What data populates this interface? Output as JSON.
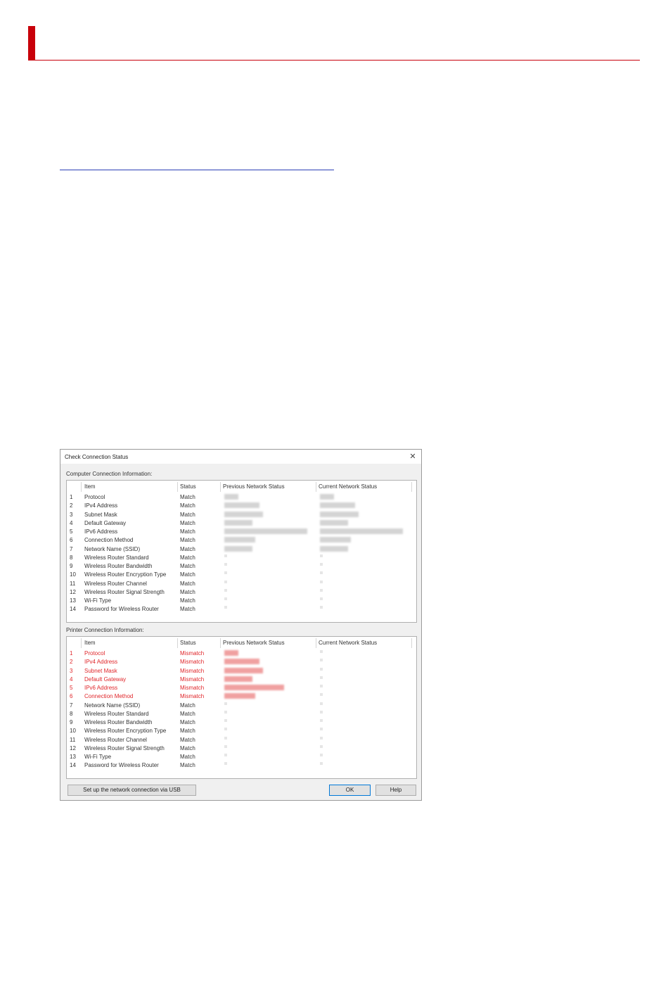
{
  "dialog": {
    "title": "Check Connection Status",
    "close_symbol": "✕",
    "columns": [
      "Item",
      "Status",
      "Previous Network Status",
      "Current Network Status"
    ],
    "computer_label": "Computer Connection Information:",
    "printer_label": "Printer Connection Information:",
    "computer_rows": [
      {
        "num": "1",
        "item": "Protocol",
        "status": "Match"
      },
      {
        "num": "2",
        "item": "IPv4 Address",
        "status": "Match"
      },
      {
        "num": "3",
        "item": "Subnet Mask",
        "status": "Match"
      },
      {
        "num": "4",
        "item": "Default Gateway",
        "status": "Match"
      },
      {
        "num": "5",
        "item": "IPv6 Address",
        "status": "Match"
      },
      {
        "num": "6",
        "item": "Connection Method",
        "status": "Match"
      },
      {
        "num": "7",
        "item": "Network Name (SSID)",
        "status": "Match"
      },
      {
        "num": "8",
        "item": "Wireless Router Standard",
        "status": "Match"
      },
      {
        "num": "9",
        "item": "Wireless Router Bandwidth",
        "status": "Match"
      },
      {
        "num": "10",
        "item": "Wireless Router Encryption Type",
        "status": "Match"
      },
      {
        "num": "11",
        "item": "Wireless Router Channel",
        "status": "Match"
      },
      {
        "num": "12",
        "item": "Wireless Router Signal Strength",
        "status": "Match"
      },
      {
        "num": "13",
        "item": "Wi-Fi Type",
        "status": "Match"
      },
      {
        "num": "14",
        "item": "Password for Wireless Router",
        "status": "Match"
      }
    ],
    "printer_rows": [
      {
        "num": "1",
        "item": "Protocol",
        "status": "Mismatch"
      },
      {
        "num": "2",
        "item": "IPv4 Address",
        "status": "Mismatch"
      },
      {
        "num": "3",
        "item": "Subnet Mask",
        "status": "Mismatch"
      },
      {
        "num": "4",
        "item": "Default Gateway",
        "status": "Mismatch"
      },
      {
        "num": "5",
        "item": "IPv6 Address",
        "status": "Mismatch"
      },
      {
        "num": "6",
        "item": "Connection Method",
        "status": "Mismatch"
      },
      {
        "num": "7",
        "item": "Network Name (SSID)",
        "status": "Match"
      },
      {
        "num": "8",
        "item": "Wireless Router Standard",
        "status": "Match"
      },
      {
        "num": "9",
        "item": "Wireless Router Bandwidth",
        "status": "Match"
      },
      {
        "num": "10",
        "item": "Wireless Router Encryption Type",
        "status": "Match"
      },
      {
        "num": "11",
        "item": "Wireless Router Channel",
        "status": "Match"
      },
      {
        "num": "12",
        "item": "Wireless Router Signal Strength",
        "status": "Match"
      },
      {
        "num": "13",
        "item": "Wi-Fi Type",
        "status": "Match"
      },
      {
        "num": "14",
        "item": "Password for Wireless Router",
        "status": "Match"
      }
    ],
    "buttons": {
      "usb_setup": "Set up the network connection via USB",
      "ok": "OK",
      "help": "Help"
    }
  },
  "colors": {
    "accent_red": "#c8000a",
    "mismatch_red": "#e0262a",
    "link_blue": "#2a3fb5"
  }
}
